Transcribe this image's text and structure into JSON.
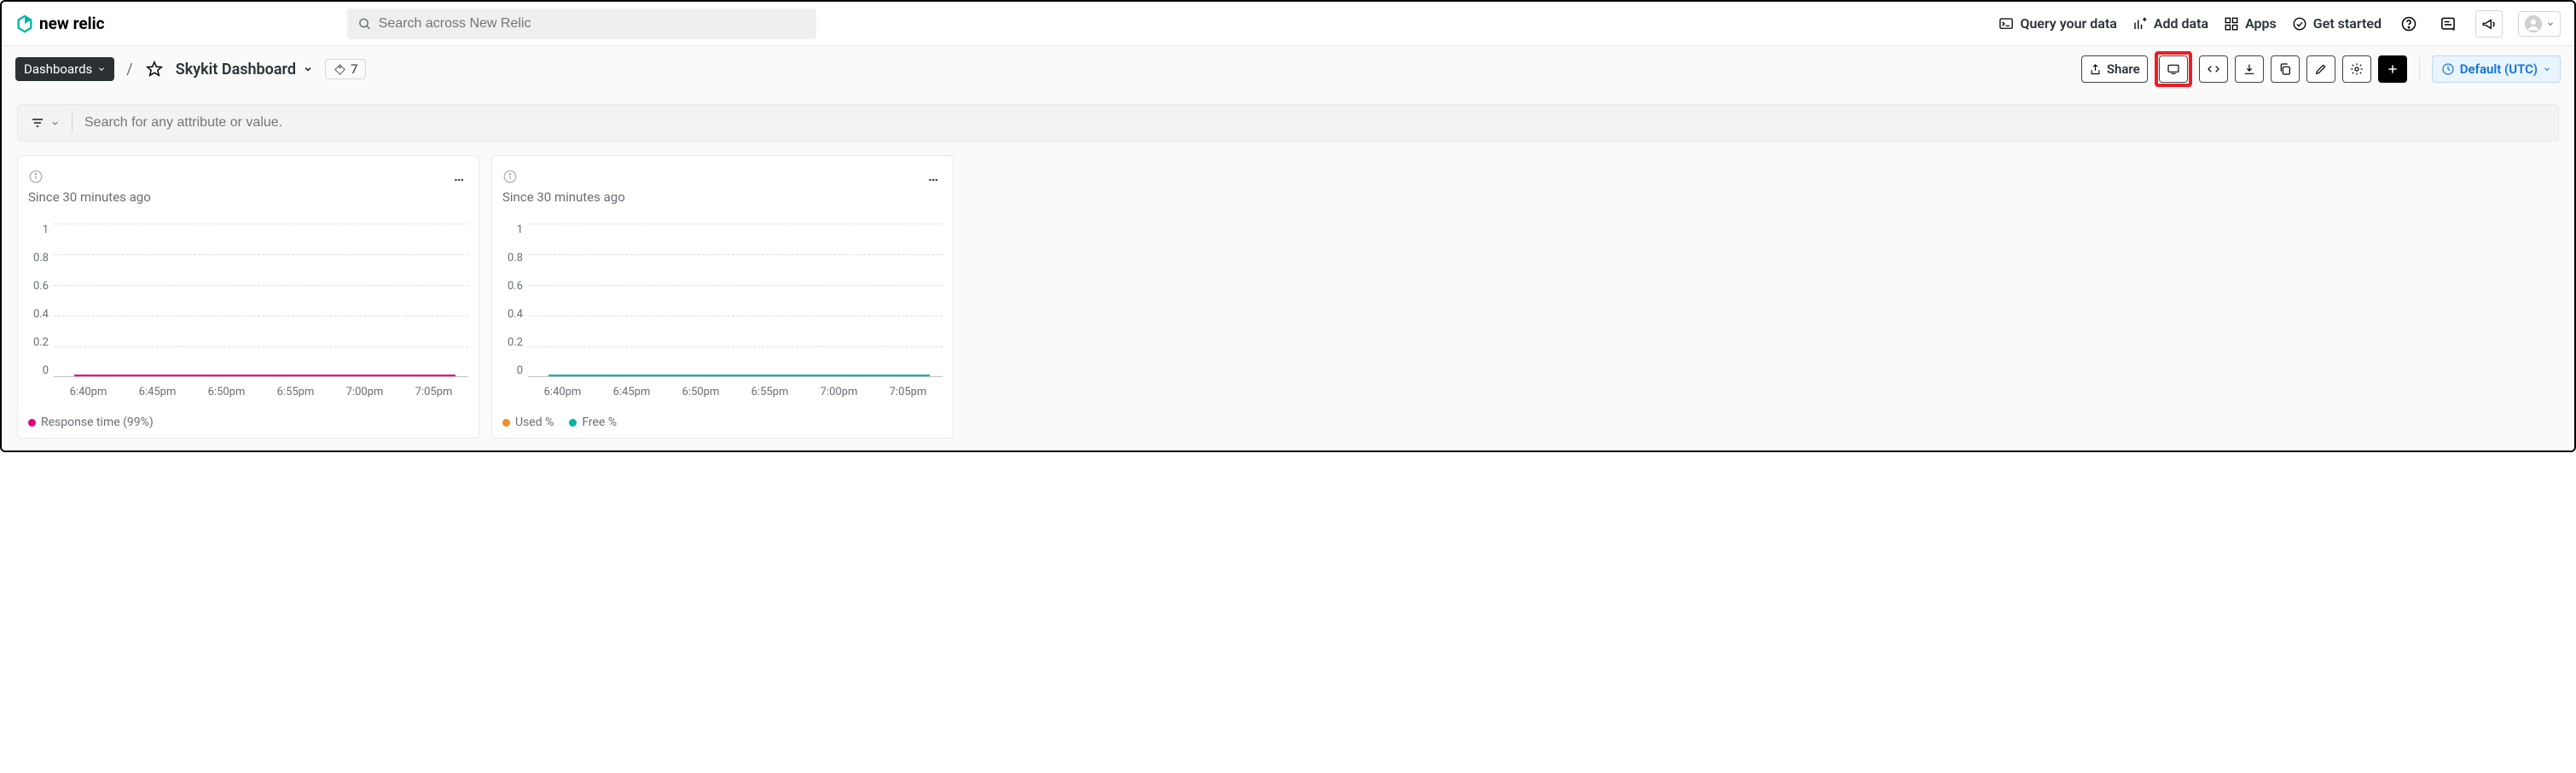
{
  "brand": {
    "name": "new relic"
  },
  "topnav": {
    "search_placeholder": "Search across New Relic",
    "items": {
      "query": "Query your data",
      "add_data": "Add data",
      "apps": "Apps",
      "get_started": "Get started"
    }
  },
  "subnav": {
    "dashboards_label": "Dashboards",
    "breadcrumb_sep": "/",
    "title": "Skykit Dashboard",
    "tag_count": "7",
    "share_label": "Share"
  },
  "timezone": {
    "label": "Default (UTC)"
  },
  "filter": {
    "placeholder": "Search for any attribute or value."
  },
  "charts": [
    {
      "subtitle": "Since 30 minutes ago",
      "legend": [
        {
          "label": "Response time (99%)",
          "color": "#E6007E"
        }
      ]
    },
    {
      "subtitle": "Since 30 minutes ago",
      "legend": [
        {
          "label": "Used %",
          "color": "#F28C28"
        },
        {
          "label": "Free %",
          "color": "#00B3A4"
        }
      ]
    }
  ],
  "chart_data": [
    {
      "type": "line",
      "title": "",
      "xlabel": "",
      "ylabel": "",
      "ylim": [
        0,
        1
      ],
      "y_ticks": [
        "1",
        "0.8",
        "0.6",
        "0.4",
        "0.2",
        "0"
      ],
      "categories": [
        "6:40pm",
        "6:45pm",
        "6:50pm",
        "6:55pm",
        "7:00pm",
        "7:05pm"
      ],
      "series": [
        {
          "name": "Response time (99%)",
          "color": "#E6007E",
          "values": [
            0.01,
            0.01,
            0.01,
            0.01,
            0.01,
            0.01
          ]
        }
      ]
    },
    {
      "type": "line",
      "title": "",
      "xlabel": "",
      "ylabel": "",
      "ylim": [
        0,
        1
      ],
      "y_ticks": [
        "1",
        "0.8",
        "0.6",
        "0.4",
        "0.2",
        "0"
      ],
      "categories": [
        "6:40pm",
        "6:45pm",
        "6:50pm",
        "6:55pm",
        "7:00pm",
        "7:05pm"
      ],
      "series": [
        {
          "name": "Used %",
          "color": "#F28C28",
          "values": [
            0.01,
            0.01,
            0.01,
            0.01,
            0.01,
            0.01
          ]
        },
        {
          "name": "Free %",
          "color": "#00B3A4",
          "values": [
            0.01,
            0.01,
            0.01,
            0.01,
            0.01,
            0.01
          ]
        }
      ]
    }
  ]
}
